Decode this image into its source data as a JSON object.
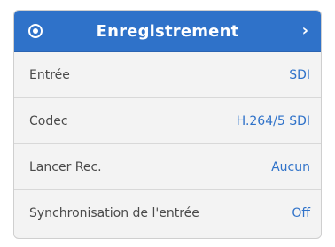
{
  "header": {
    "title": "Enregistrement",
    "left_icon": "radio-selected-icon",
    "right_icon": "chevron-right-icon",
    "chevron": "›",
    "accent_color": "#2f72c9"
  },
  "rows": [
    {
      "label": "Entrée",
      "value": "SDI"
    },
    {
      "label": "Codec",
      "value": "H.264/5 SDI"
    },
    {
      "label": "Lancer Rec.",
      "value": "Aucun"
    },
    {
      "label": "Synchronisation de l'entrée",
      "value": "Off"
    }
  ]
}
